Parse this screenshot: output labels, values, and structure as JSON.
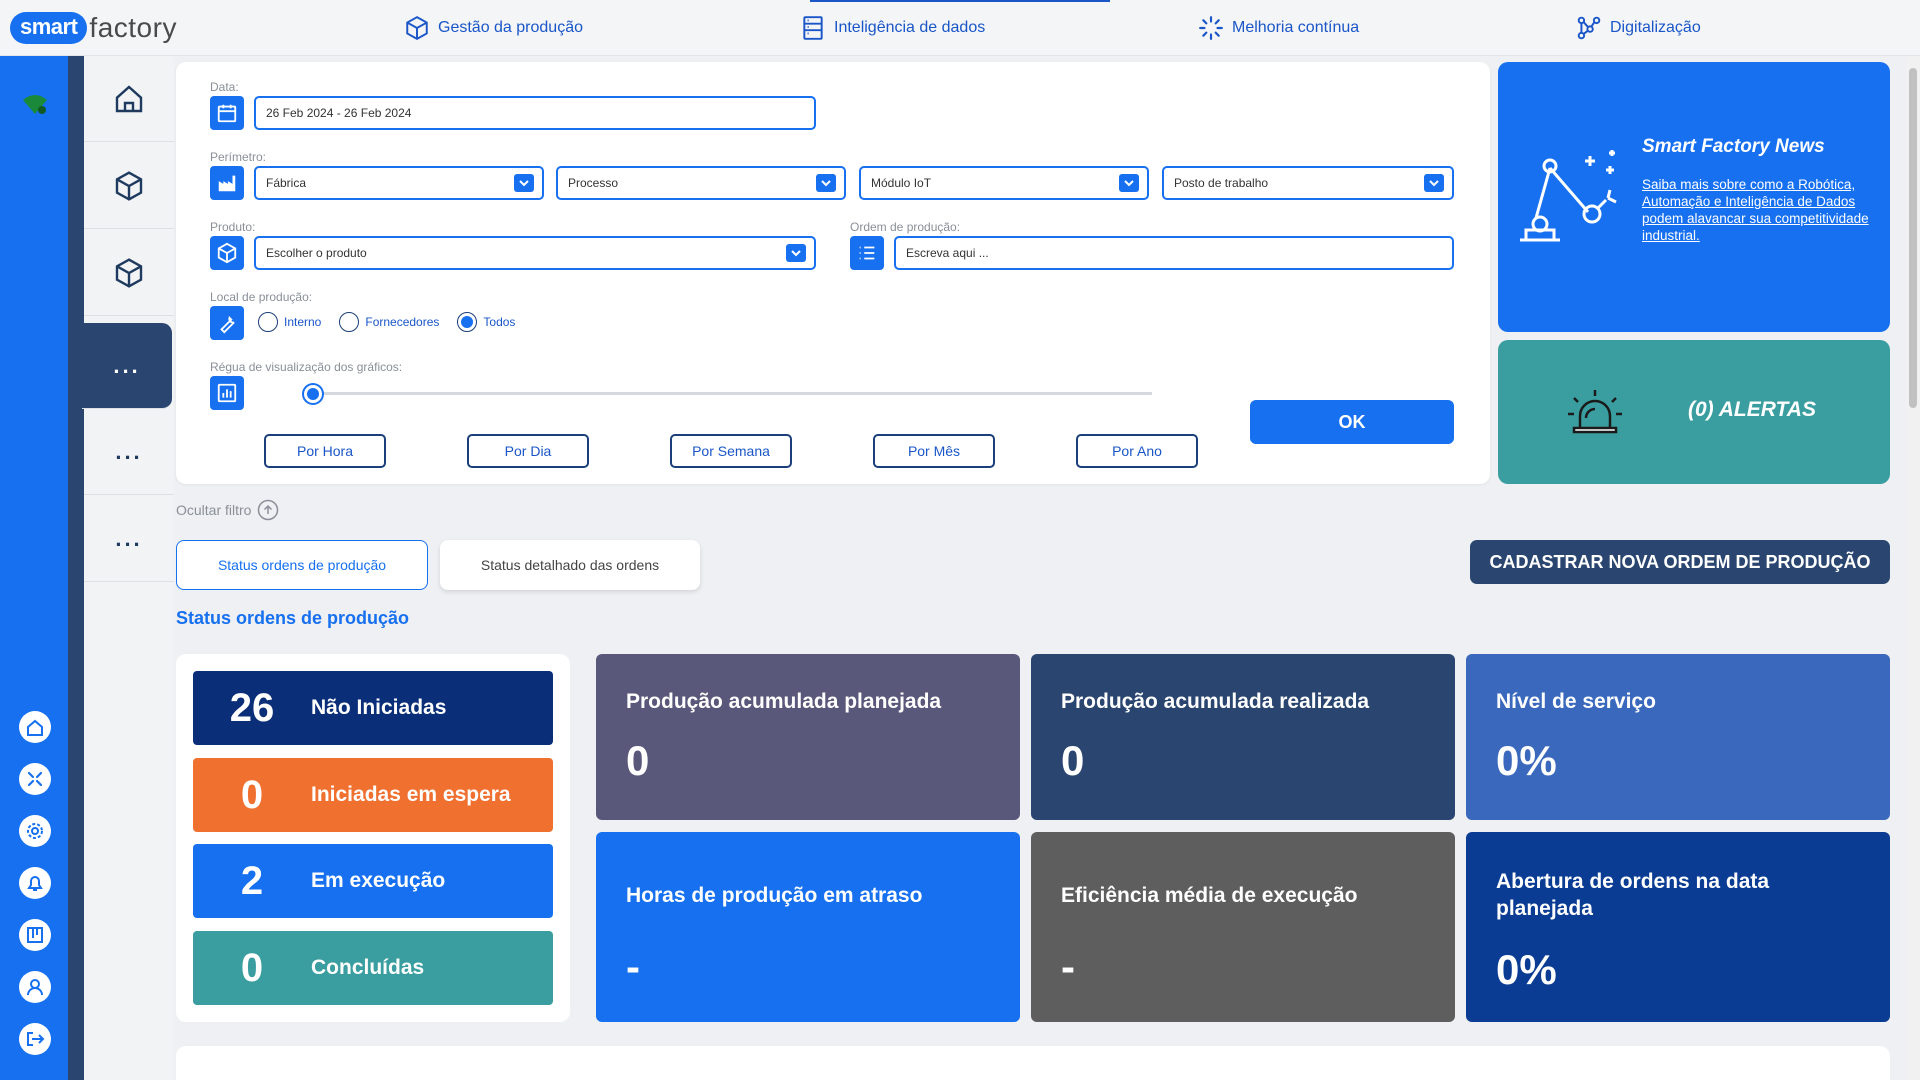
{
  "brand": {
    "part1": "smart",
    "part2": "factory"
  },
  "nav": [
    {
      "label": "Gestão da produção",
      "icon": "cube-icon"
    },
    {
      "label": "Inteligência de dados",
      "icon": "database-icon"
    },
    {
      "label": "Melhoria contínua",
      "icon": "loader-icon"
    },
    {
      "label": "Digitalização",
      "icon": "network-icon"
    }
  ],
  "rail_icons": [
    "home-icon",
    "move-icon",
    "settings-icon",
    "bell-icon",
    "board-icon",
    "user-icon",
    "logout-icon"
  ],
  "subbar": [
    {
      "icon": "home-icon"
    },
    {
      "icon": "cube-icon"
    },
    {
      "icon": "cube-icon"
    },
    {
      "icon": "more-icon",
      "label": "...",
      "active": true
    },
    {
      "icon": "more-icon",
      "label": "..."
    },
    {
      "icon": "more-icon",
      "label": "..."
    }
  ],
  "filters": {
    "date_label": "Data:",
    "date_value": "26 Feb 2024 - 26 Feb 2024",
    "perimeter_label": "Perímetro:",
    "perimeter": [
      "Fábrica",
      "Processo",
      "Módulo IoT",
      "Posto de trabalho"
    ],
    "product_label": "Produto:",
    "product_value": "Escolher o produto",
    "order_label": "Ordem de produção:",
    "order_placeholder": "Escreva aqui ...",
    "location_label": "Local de produção:",
    "location_options": [
      "Interno",
      "Fornecedores",
      "Todos"
    ],
    "location_selected": "Todos",
    "ruler_label": "Régua de visualização dos gráficos:",
    "ruler_position": 0,
    "periods": [
      "Por Hora",
      "Por Dia",
      "Por Semana",
      "Por Mês",
      "Por Ano"
    ],
    "ok_label": "OK"
  },
  "news": {
    "title": "Smart Factory News",
    "link": "Saiba mais sobre como a Robótica, Automação e Inteligência de Dados podem alavancar sua competitividade industrial."
  },
  "alerts": {
    "text": "(0) ALERTAS"
  },
  "hide_filter": "Ocultar filtro",
  "tabs": [
    {
      "label": "Status ordens de produção",
      "active": true
    },
    {
      "label": "Status detalhado das ordens",
      "active": false
    }
  ],
  "new_order_button": "CADASTRAR NOVA ORDEM DE PRODUÇÃO",
  "section_title": "Status ordens de produção",
  "status": [
    {
      "count": "26",
      "label": "Não Iniciadas",
      "color": "#0a2f78"
    },
    {
      "count": "0",
      "label": "Iniciadas em espera",
      "color": "#f07030"
    },
    {
      "count": "2",
      "label": "Em execução",
      "color": "#1670f0"
    },
    {
      "count": "0",
      "label": "Concluídas",
      "color": "#3a9ea0"
    }
  ],
  "kpis": [
    {
      "title": "Produção acumulada planejada",
      "value": "0",
      "color": "#5a587a"
    },
    {
      "title": "Produção acumulada realizada",
      "value": "0",
      "color": "#2a4670"
    },
    {
      "title": "Nível de serviço",
      "value": "0%",
      "color": "#3a68bc"
    },
    {
      "title": "Horas de produção em atraso",
      "value": "-",
      "color": "#1670f0"
    },
    {
      "title": "Eficiência média de execução",
      "value": "-",
      "color": "#5e5e5e"
    },
    {
      "title": "Abertura de ordens na data planejada",
      "value": "0%",
      "color": "#0a3c94"
    }
  ],
  "colors": {
    "primary": "#1670f0",
    "navy": "#2a4670",
    "teal": "#3a9ea0"
  }
}
